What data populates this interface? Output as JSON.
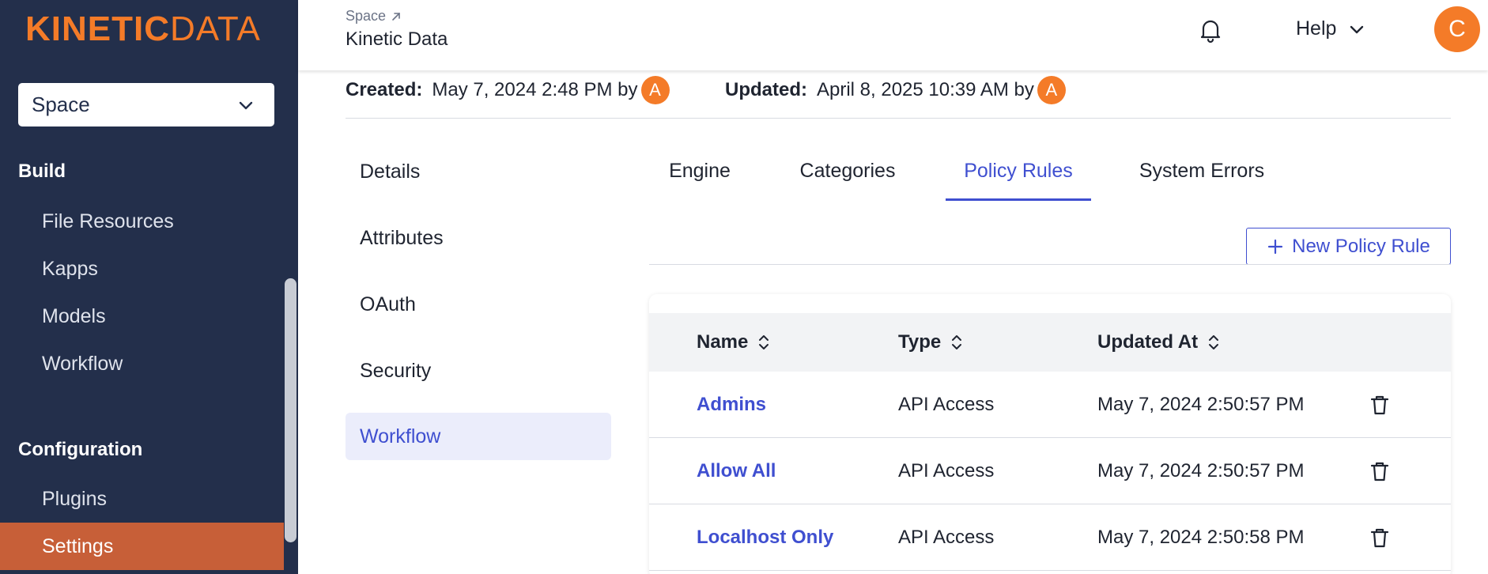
{
  "sidebar": {
    "logo_bold": "KINETIC",
    "logo_light": "DATA",
    "space_select": {
      "value": "Space"
    },
    "build_heading": "Build",
    "build_items": [
      "File Resources",
      "Kapps",
      "Models",
      "Workflow"
    ],
    "config_heading": "Configuration",
    "config_items": [
      "Plugins",
      "Settings"
    ],
    "active_item": "Settings"
  },
  "header": {
    "breadcrumb": "Space",
    "title": "Kinetic Data",
    "help_label": "Help",
    "user_initial": "C"
  },
  "meta": {
    "created_label": "Created:",
    "created_value": "May 7, 2024 2:48 PM by",
    "created_by_initial": "A",
    "updated_label": "Updated:",
    "updated_value": "April 8, 2025 10:39 AM by",
    "updated_by_initial": "A"
  },
  "settings_menu": {
    "items": [
      "Details",
      "Attributes",
      "OAuth",
      "Security",
      "Workflow"
    ],
    "active": "Workflow"
  },
  "tabs": {
    "items": [
      "Engine",
      "Categories",
      "Policy Rules",
      "System Errors"
    ],
    "active": "Policy Rules"
  },
  "actions": {
    "new_policy_rule": "New Policy Rule"
  },
  "table": {
    "columns": [
      "Name",
      "Type",
      "Updated At"
    ],
    "rows": [
      {
        "name": "Admins",
        "type": "API Access",
        "updated_at": "May 7, 2024 2:50:57 PM"
      },
      {
        "name": "Allow All",
        "type": "API Access",
        "updated_at": "May 7, 2024 2:50:57 PM"
      },
      {
        "name": "Localhost Only",
        "type": "API Access",
        "updated_at": "May 7, 2024 2:50:58 PM"
      }
    ]
  },
  "colors": {
    "sidebar_bg": "#232f4b",
    "brand_orange": "#f47b28",
    "active_nav": "#c75f38",
    "accent_blue": "#3f4fd0"
  },
  "icons": [
    "chevron-down-icon",
    "external-link-icon",
    "bell-icon",
    "plus-icon",
    "sort-icon",
    "trash-icon"
  ]
}
